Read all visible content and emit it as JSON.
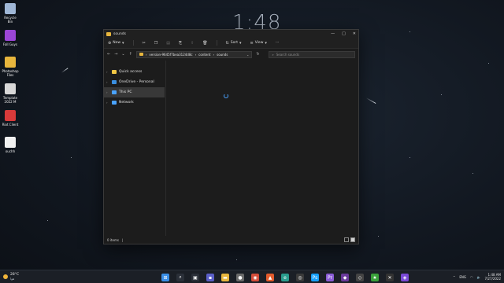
{
  "desktop": {
    "clock": "1:48",
    "icons": [
      {
        "label": "Recycle Bin",
        "icon": "recycle-bin-icon",
        "color": "#9fb7d6"
      },
      {
        "label": "Fall Guys",
        "icon": "fall-guys-icon",
        "color": "#9b46d6"
      },
      {
        "label": "Photoshop Files",
        "icon": "folder-icon",
        "color": "#e8b63d"
      },
      {
        "label": "Template 2022 M",
        "icon": "template-icon",
        "color": "#d8d8d8"
      },
      {
        "label": "Riot Client",
        "icon": "riot-client-icon",
        "color": "#d83a3a"
      },
      {
        "label": "ouchh",
        "icon": "file-icon",
        "color": "#f0f0f0"
      }
    ]
  },
  "explorer": {
    "title": "sounds",
    "toolbar": {
      "new_label": "New",
      "sort_label": "Sort",
      "view_label": "View",
      "more_label": "···"
    },
    "address": {
      "segments": [
        "version-9645f7bea3124d8c",
        "content",
        "sounds"
      ]
    },
    "search": {
      "placeholder": "Search sounds"
    },
    "nav": [
      {
        "label": "Quick access",
        "icon": "star-icon",
        "color": "#f2c744"
      },
      {
        "label": "OneDrive - Personal",
        "icon": "onedrive-icon",
        "color": "#3b8fe0"
      },
      {
        "label": "This PC",
        "icon": "pc-icon",
        "color": "#4aa3ff"
      },
      {
        "label": "Network",
        "icon": "network-icon",
        "color": "#4aa3ff"
      }
    ],
    "status": "0 items"
  },
  "taskbar": {
    "weather_temp": "28°C",
    "weather_desc": "هوا",
    "apps": [
      {
        "name": "start-icon",
        "color": "#3a8ee6",
        "glyph": "⊞"
      },
      {
        "name": "search-icon",
        "color": "#2a2f38",
        "glyph": "⌕"
      },
      {
        "name": "task-view-icon",
        "color": "#2a2f38",
        "glyph": "▣"
      },
      {
        "name": "chat-icon",
        "color": "#5b5fc7",
        "glyph": "▪"
      },
      {
        "name": "file-explorer-icon",
        "color": "#e8b63d",
        "glyph": "▬"
      },
      {
        "name": "app-icon",
        "color": "#6a6a6a",
        "glyph": "●"
      },
      {
        "name": "chrome-icon",
        "color": "#d44d3a",
        "glyph": "◉"
      },
      {
        "name": "brave-icon",
        "color": "#e35b2c",
        "glyph": "▲"
      },
      {
        "name": "edge-icon",
        "color": "#2a9c8d",
        "glyph": "e"
      },
      {
        "name": "obs-icon",
        "color": "#3a3a3a",
        "glyph": "◎"
      },
      {
        "name": "photoshop-icon",
        "color": "#17a0fb",
        "glyph": "Ps"
      },
      {
        "name": "premiere-icon",
        "color": "#8a5cd6",
        "glyph": "Pr"
      },
      {
        "name": "app2-icon",
        "color": "#6a3a9c",
        "glyph": "◆"
      },
      {
        "name": "app3-icon",
        "color": "#444444",
        "glyph": "◇"
      },
      {
        "name": "app4-icon",
        "color": "#3aa03a",
        "glyph": "★"
      },
      {
        "name": "app5-icon",
        "color": "#333333",
        "glyph": "✕"
      },
      {
        "name": "app6-icon",
        "color": "#7a4ad6",
        "glyph": "◈"
      }
    ],
    "lang": "ENG",
    "time": "1:48 AM",
    "date": "7/27/2022"
  }
}
